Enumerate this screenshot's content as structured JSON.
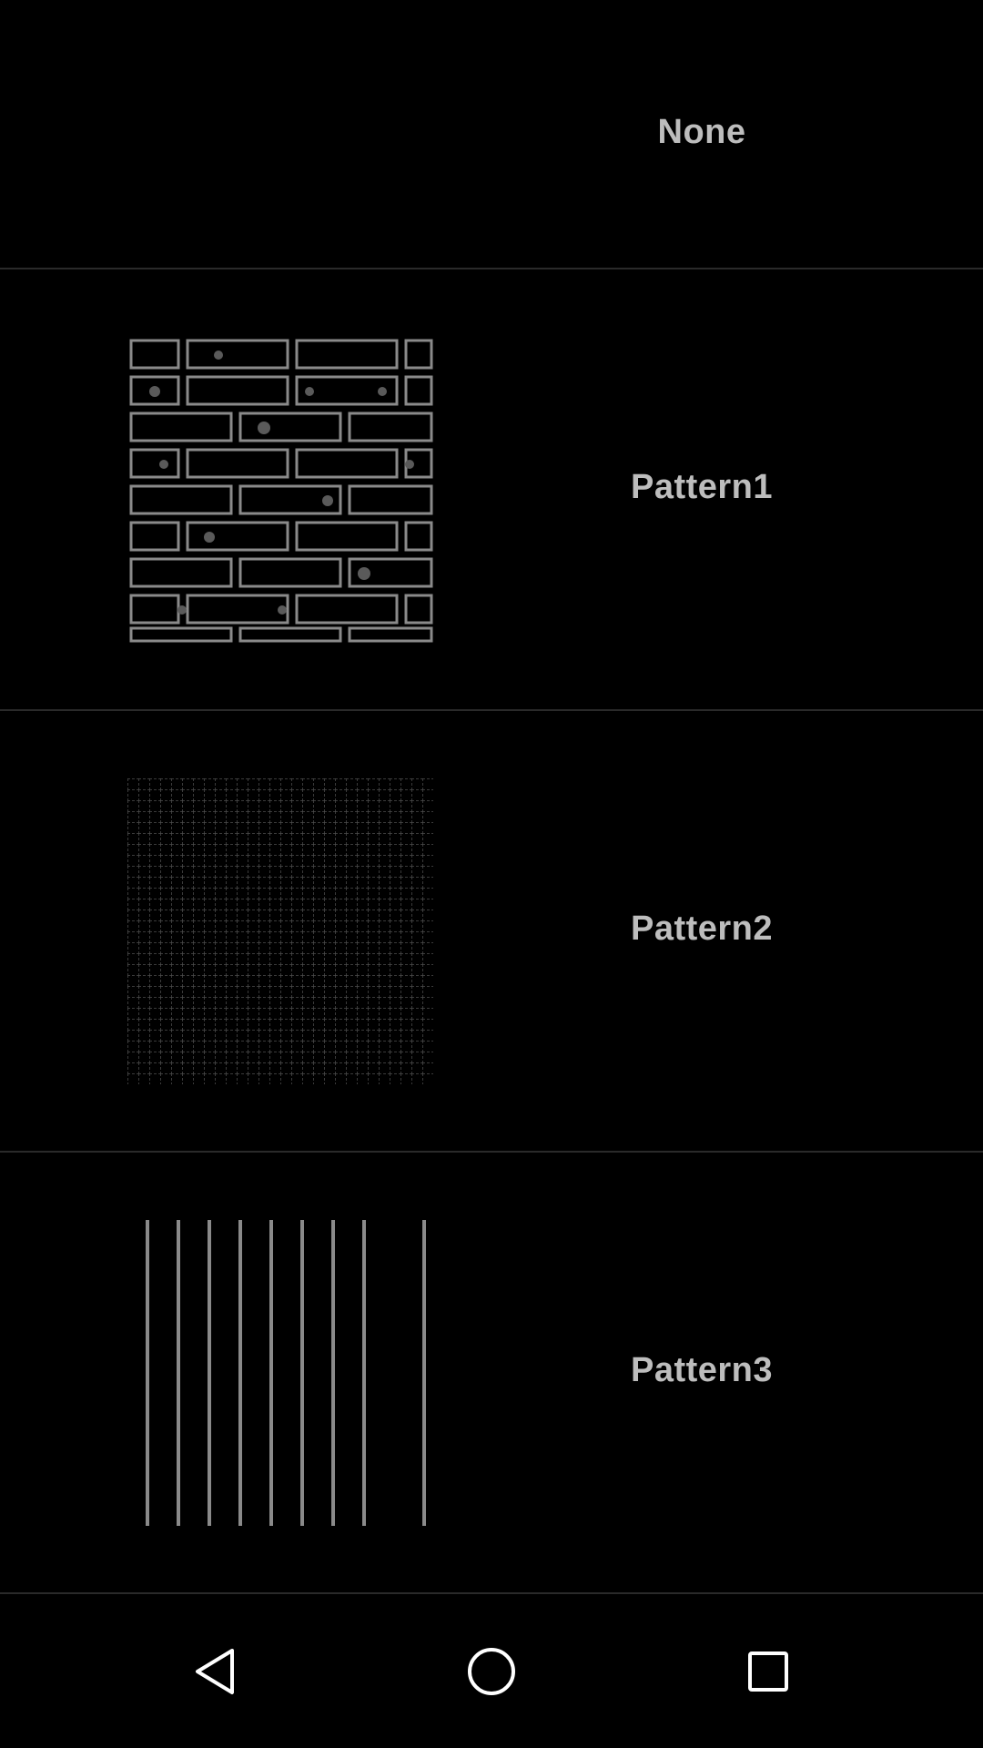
{
  "patterns": {
    "items": [
      {
        "label": "None",
        "thumbnail": "none"
      },
      {
        "label": "Pattern1",
        "thumbnail": "brick-wall-pattern-icon"
      },
      {
        "label": "Pattern2",
        "thumbnail": "grid-mesh-pattern-icon"
      },
      {
        "label": "Pattern3",
        "thumbnail": "vertical-stripes-pattern-icon"
      }
    ]
  },
  "navbar": {
    "back_icon": "back-triangle-icon",
    "home_icon": "home-circle-icon",
    "recent_icon": "recent-apps-square-icon"
  },
  "colors": {
    "background": "#000000",
    "label_text": "#bdbdbd",
    "divider": "#2a2a2a",
    "pattern_stroke": "#8a8a8a",
    "nav_icon": "#ffffff"
  }
}
